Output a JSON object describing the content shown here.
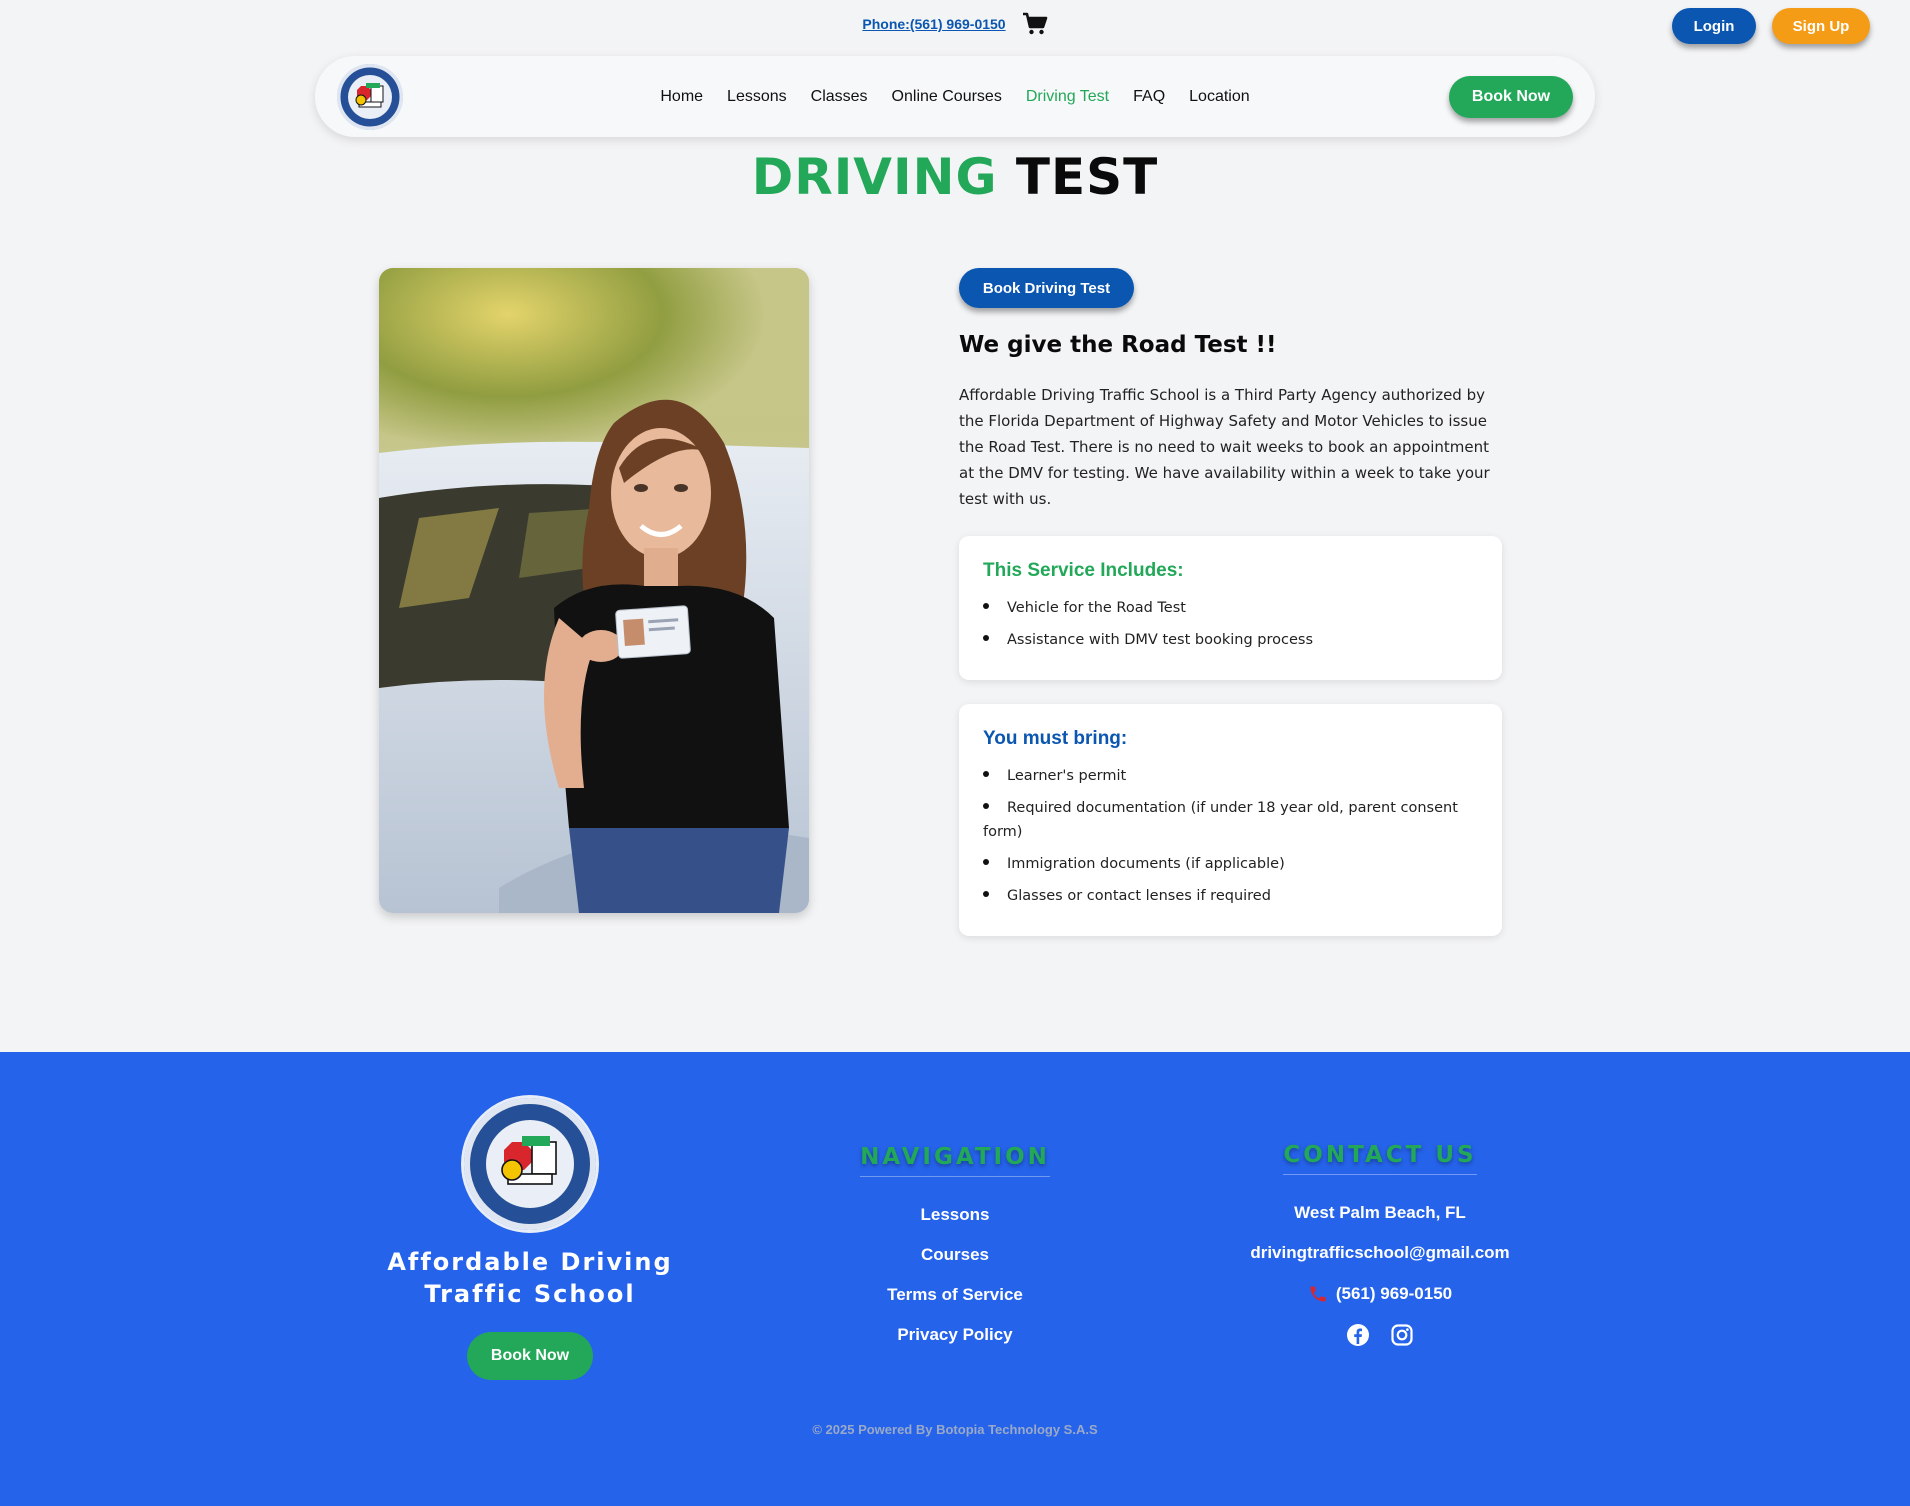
{
  "topbar": {
    "phone_text": "Phone:(561) 969-0150",
    "cart_icon": "cart-icon",
    "login_label": "Login",
    "signup_label": "Sign Up"
  },
  "navbar": {
    "logo_text": "Affordable Driving Traffic School",
    "links": [
      "Home",
      "Lessons",
      "Classes",
      "Online Courses",
      "Driving Test",
      "FAQ",
      "Location"
    ],
    "active": "Driving Test",
    "book_now_label": "Book Now"
  },
  "page": {
    "title_part1": "DRIVING",
    "title_part2": "TEST",
    "book_test_label": "Book Driving Test",
    "heading": "We give the Road Test !!",
    "intro": "Affordable Driving Traffic School is a Third Party Agency authorized by the Florida Department of Highway Safety and Motor Vehicles to issue the Road Test. There is no need to wait weeks to book an appointment at the DMV for testing. We have availability within a week to take your test with us."
  },
  "includes": {
    "title": "This Service Includes:",
    "items": [
      "Vehicle for the Road Test",
      "Assistance with DMV test booking process"
    ]
  },
  "bring": {
    "title": "You must bring:",
    "items": [
      "Learner's permit",
      "Required documentation (if under 18 year old, parent consent form)",
      "Immigration documents (if applicable)",
      "Glasses or contact lenses if required"
    ]
  },
  "footer": {
    "brand_name": "Affordable Driving Traffic School",
    "book_now_label": "Book Now",
    "nav_heading": "NAVIGATION",
    "nav_links": [
      "Lessons",
      "Courses",
      "Terms of Service",
      "Privacy Policy"
    ],
    "contact_heading": "CONTACT US",
    "city": "West Palm Beach, FL",
    "email": "drivingtrafficschool@gmail.com",
    "phone": "(561) 969-0150",
    "copyright": "© 2025 Powered By Botopia Technology S.A.S"
  },
  "colors": {
    "brand_green": "#22a858",
    "brand_blue": "#0a56b0",
    "footer_blue": "#2563eb",
    "signup_orange": "#f59c16"
  }
}
